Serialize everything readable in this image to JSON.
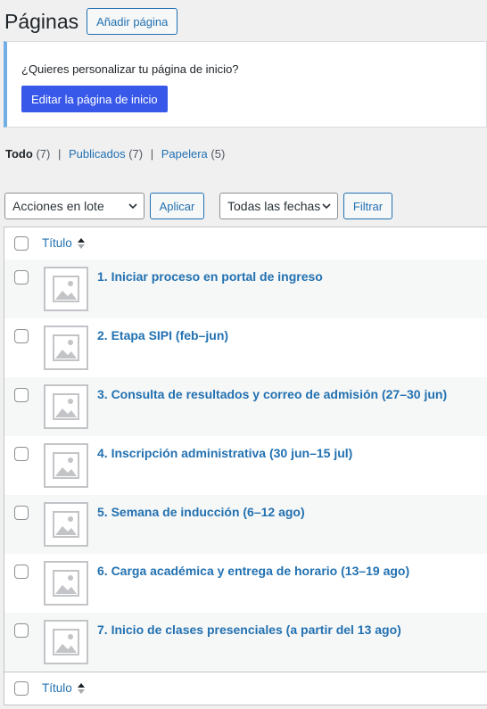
{
  "header": {
    "title": "Páginas",
    "add_new": "Añadir página"
  },
  "notice": {
    "text": "¿Quieres personalizar tu página de inicio?",
    "button": "Editar la página de inicio"
  },
  "views": [
    {
      "label": "Todo",
      "count": "(7)"
    },
    {
      "label": "Publicados",
      "count": "(7)"
    },
    {
      "label": "Papelera",
      "count": "(5)"
    }
  ],
  "views_separator": "|",
  "bulk_actions": {
    "selected": "Acciones en lote",
    "apply": "Aplicar"
  },
  "date_filter": {
    "selected": "Todas las fechas",
    "filter": "Filtrar"
  },
  "table": {
    "column_title": "Título",
    "rows": [
      {
        "title": "1. Iniciar proceso en portal de ingreso"
      },
      {
        "title": "2. Etapa SIPI (feb–jun)"
      },
      {
        "title": "3. Consulta de resultados y correo de admisión (27–30 jun)"
      },
      {
        "title": "4. Inscripción administrativa (30 jun–15 jul)"
      },
      {
        "title": "5. Semana de inducción (6–12 ago)"
      },
      {
        "title": "6. Carga académica y entrega de horario (13–19 ago)"
      },
      {
        "title": "7. Inicio de clases presenciales (a partir del 13 ago)"
      }
    ]
  },
  "colors": {
    "link": "#2271b1",
    "primary_button": "#3858e9",
    "notice_accent": "#72aee6"
  },
  "icons": {
    "sort": "sort-arrows-icon",
    "thumbnail": "image-placeholder-icon",
    "dropdown": "chevron-down-icon"
  }
}
